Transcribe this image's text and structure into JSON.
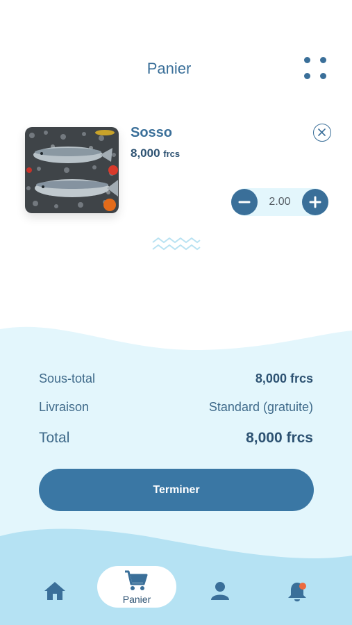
{
  "header": {
    "title": "Panier",
    "menu_icon": "grid-dots-icon"
  },
  "cart_item": {
    "name": "Sosso",
    "price": "8,000",
    "price_unit": "frcs",
    "quantity": "2.00",
    "image": "fish-photo",
    "remove_icon": "close-circle-icon"
  },
  "summary": {
    "subtotal_label": "Sous-total",
    "subtotal_value": "8,000 frcs",
    "delivery_label": "Livraison",
    "delivery_value": "Standard (gratuite)",
    "total_label": "Total",
    "total_value": "8,000 frcs"
  },
  "actions": {
    "finish_label": "Terminer"
  },
  "bottom_nav": {
    "items": [
      {
        "icon": "home-icon",
        "label": ""
      },
      {
        "icon": "cart-icon",
        "label": "Panier",
        "active": true
      },
      {
        "icon": "user-icon",
        "label": ""
      },
      {
        "icon": "bell-icon",
        "label": "",
        "badge": true
      }
    ]
  },
  "colors": {
    "primary": "#3a6f99",
    "button": "#3a77a4",
    "light_wave": "#e3f6fc",
    "nav_wave": "#b5e2f3",
    "badge": "#ec6a3e"
  }
}
